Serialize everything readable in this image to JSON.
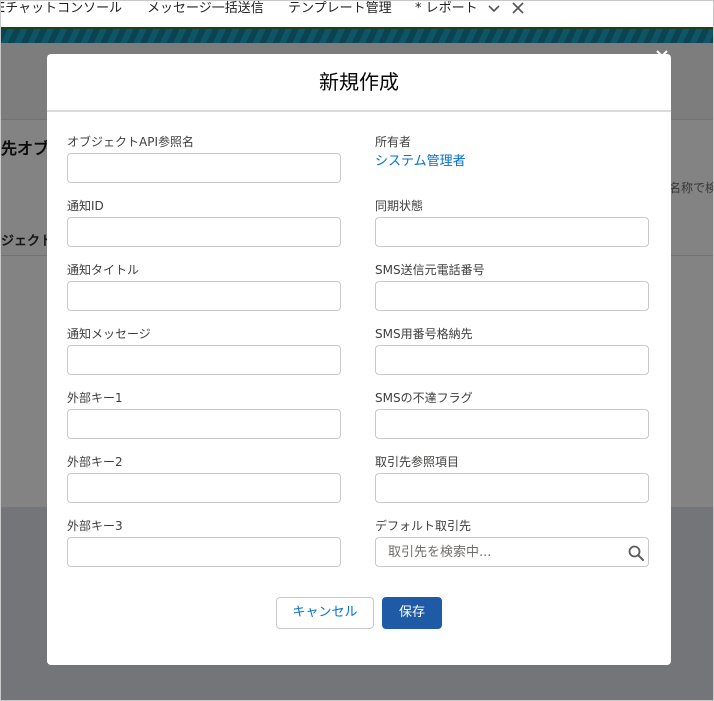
{
  "app_tabs": [
    {
      "label": "Eチャットコンソール"
    },
    {
      "label": "メッセージ一括送信"
    },
    {
      "label": "テンプレート管理"
    },
    {
      "label": "* レポート"
    }
  ],
  "background": {
    "page_title_fragment": "先オブ",
    "search_fragment": "名称で検",
    "column_fragment": "ジェクト"
  },
  "colors": {
    "accent": "#0070d2",
    "brand_button": "#1f5aa6",
    "backdrop": "#080707"
  },
  "modal": {
    "title": "新規作成",
    "close_icon": "close-icon",
    "left_fields": [
      {
        "label": "オブジェクトAPI参照名",
        "value": ""
      },
      {
        "label": "通知ID",
        "value": ""
      },
      {
        "label": "通知タイトル",
        "value": ""
      },
      {
        "label": "通知メッセージ",
        "value": ""
      },
      {
        "label": "外部キー1",
        "value": ""
      },
      {
        "label": "外部キー2",
        "value": ""
      },
      {
        "label": "外部キー3",
        "value": ""
      }
    ],
    "owner": {
      "label": "所有者",
      "value": "システム管理者"
    },
    "right_fields": [
      {
        "label": "同期状態",
        "value": ""
      },
      {
        "label": "SMS送信元電話番号",
        "value": ""
      },
      {
        "label": "SMS用番号格納先",
        "value": ""
      },
      {
        "label": "SMSの不達フラグ",
        "value": ""
      },
      {
        "label": "取引先参照項目",
        "value": ""
      }
    ],
    "lookup": {
      "label": "デフォルト取引先",
      "placeholder": "取引先を検索中...",
      "icon": "search-icon"
    },
    "buttons": {
      "cancel": "キャンセル",
      "save": "保存"
    }
  }
}
